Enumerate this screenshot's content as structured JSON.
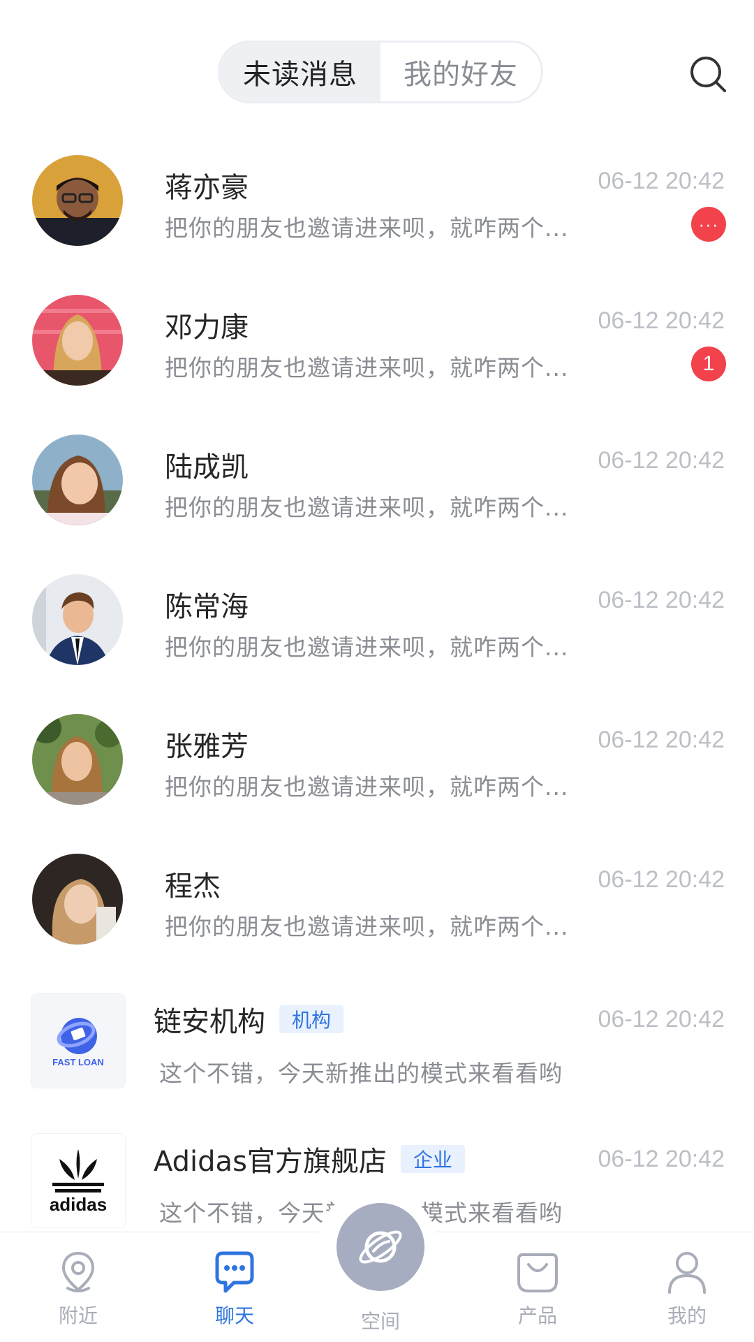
{
  "header": {
    "tabs": [
      {
        "label": "未读消息",
        "active": true
      },
      {
        "label": "我的好友",
        "active": false
      }
    ],
    "search_icon": "search-icon"
  },
  "conversations": [
    {
      "name": "蒋亦豪",
      "time": "06-12 20:42",
      "preview": "把你的朋友也邀请进来呗，就咋两个...",
      "badge": "···",
      "avatar": "man-with-glasses"
    },
    {
      "name": "邓力康",
      "time": "06-12 20:42",
      "preview": "把你的朋友也邀请进来呗，就咋两个...",
      "badge": "1",
      "avatar": "blonde-woman"
    },
    {
      "name": "陆成凯",
      "time": "06-12 20:42",
      "preview": "把你的朋友也邀请进来呗，就咋两个...",
      "badge": "",
      "avatar": "smiling-woman"
    },
    {
      "name": "陈常海",
      "time": "06-12 20:42",
      "preview": "把你的朋友也邀请进来呗，就咋两个...",
      "badge": "",
      "avatar": "man-in-suit"
    },
    {
      "name": "张雅芳",
      "time": "06-12 20:42",
      "preview": "把你的朋友也邀请进来呗，就咋两个...",
      "badge": "",
      "avatar": "woman-outdoors"
    },
    {
      "name": "程杰",
      "time": "06-12 20:42",
      "preview": "把你的朋友也邀请进来呗，就咋两个...",
      "badge": "",
      "avatar": "laughing-woman"
    },
    {
      "name": "链安机构",
      "tag": "机构",
      "time": "06-12 20:42",
      "preview": "这个不错，今天新推出的模式来看看哟",
      "logo": "fast-loan-logo",
      "logo_text": "FAST LOAN"
    },
    {
      "name": "Adidas官方旗舰店",
      "tag": "企业",
      "time": "06-12 20:42",
      "preview": "这个不错，今天新推出的模式来看看哟",
      "logo": "adidas-logo",
      "logo_text": "adidas"
    }
  ],
  "tabbar": {
    "items": [
      {
        "label": "附近",
        "icon": "location-pin-icon",
        "active": false
      },
      {
        "label": "聊天",
        "icon": "chat-bubble-icon",
        "active": true
      },
      {
        "label": "空间",
        "icon": "planet-icon",
        "active": false
      },
      {
        "label": "产品",
        "icon": "shopping-bag-icon",
        "active": false
      },
      {
        "label": "我的",
        "icon": "user-icon",
        "active": false
      }
    ]
  },
  "colors": {
    "accent": "#2f74e0",
    "badge": "#f2424b",
    "muted": "#a8adb8",
    "center_button": "#a7adc0"
  }
}
